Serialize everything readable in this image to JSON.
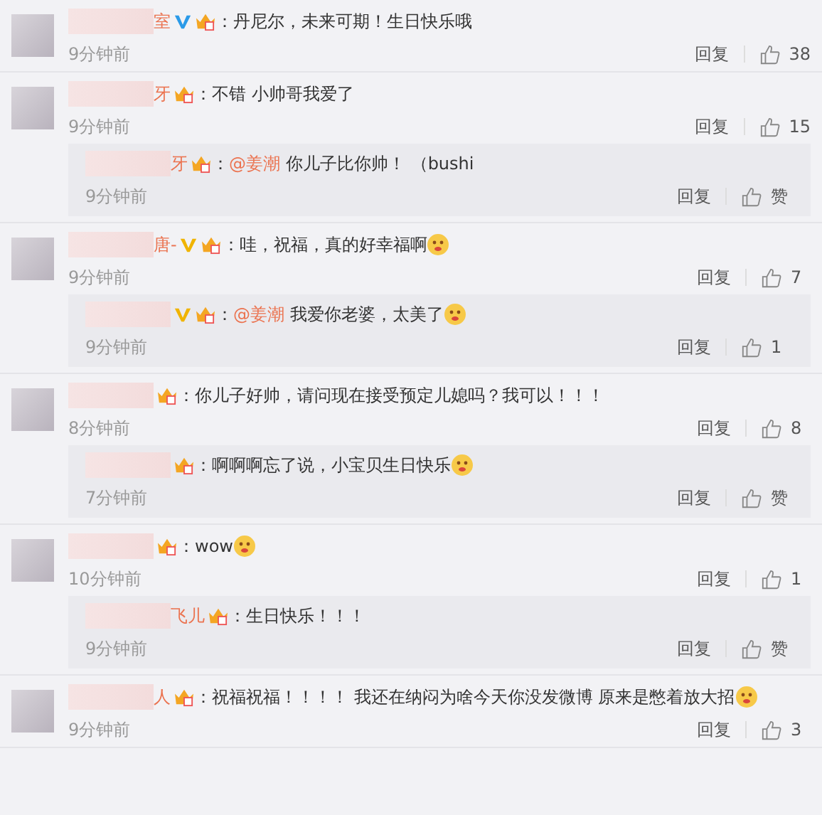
{
  "comments": [
    {
      "name": "室",
      "verified": {
        "color": "#2a9ae8"
      },
      "separator": "：",
      "text": "丹尼尔，未来可期！生日快乐哦",
      "time": "9分钟前",
      "reply": "回复",
      "like": "38"
    },
    {
      "name": "牙",
      "separator": "：",
      "text": "不错 小帅哥我爱了",
      "time": "9分钟前",
      "reply": "回复",
      "like": "15",
      "replies": [
        {
          "name": "牙",
          "separator": "：",
          "mention": "@姜潮",
          "text": "你儿子比你帅！ （bushi",
          "time": "9分钟前",
          "reply": "回复",
          "like": "赞"
        }
      ]
    },
    {
      "name": "唐-",
      "verified": {
        "color": "#f0b400"
      },
      "separator": "：",
      "text": "哇，祝福，真的好幸福啊",
      "emoji": true,
      "time": "9分钟前",
      "reply": "回复",
      "like": "7",
      "replies": [
        {
          "verified": {
            "color": "#f0b400"
          },
          "separator": "：",
          "mention": "@姜潮",
          "text": "我爱你老婆，太美了",
          "emoji": true,
          "time": "9分钟前",
          "reply": "回复",
          "like": "1"
        }
      ]
    },
    {
      "separator": "：",
      "text": "你儿子好帅，请问现在接受预定儿媳吗？我可以！！！",
      "time": "8分钟前",
      "reply": "回复",
      "like": "8",
      "replies": [
        {
          "separator": "：",
          "text": "啊啊啊忘了说，小宝贝生日快乐",
          "emoji": true,
          "time": "7分钟前",
          "reply": "回复",
          "like": "赞"
        }
      ]
    },
    {
      "separator": "：",
      "text": "wow",
      "emoji": true,
      "time": "10分钟前",
      "reply": "回复",
      "like": "1",
      "replies": [
        {
          "name": "飞儿",
          "separator": "：",
          "text": "生日快乐！！！",
          "time": "9分钟前",
          "reply": "回复",
          "like": "赞"
        }
      ]
    },
    {
      "name": "人",
      "separator": "：",
      "text": "祝福祝福！！！！ 我还在纳闷为啥今天你没发微博 原来是憋着放大招",
      "emoji": true,
      "time": "9分钟前",
      "reply": "回复",
      "like": "3"
    }
  ]
}
